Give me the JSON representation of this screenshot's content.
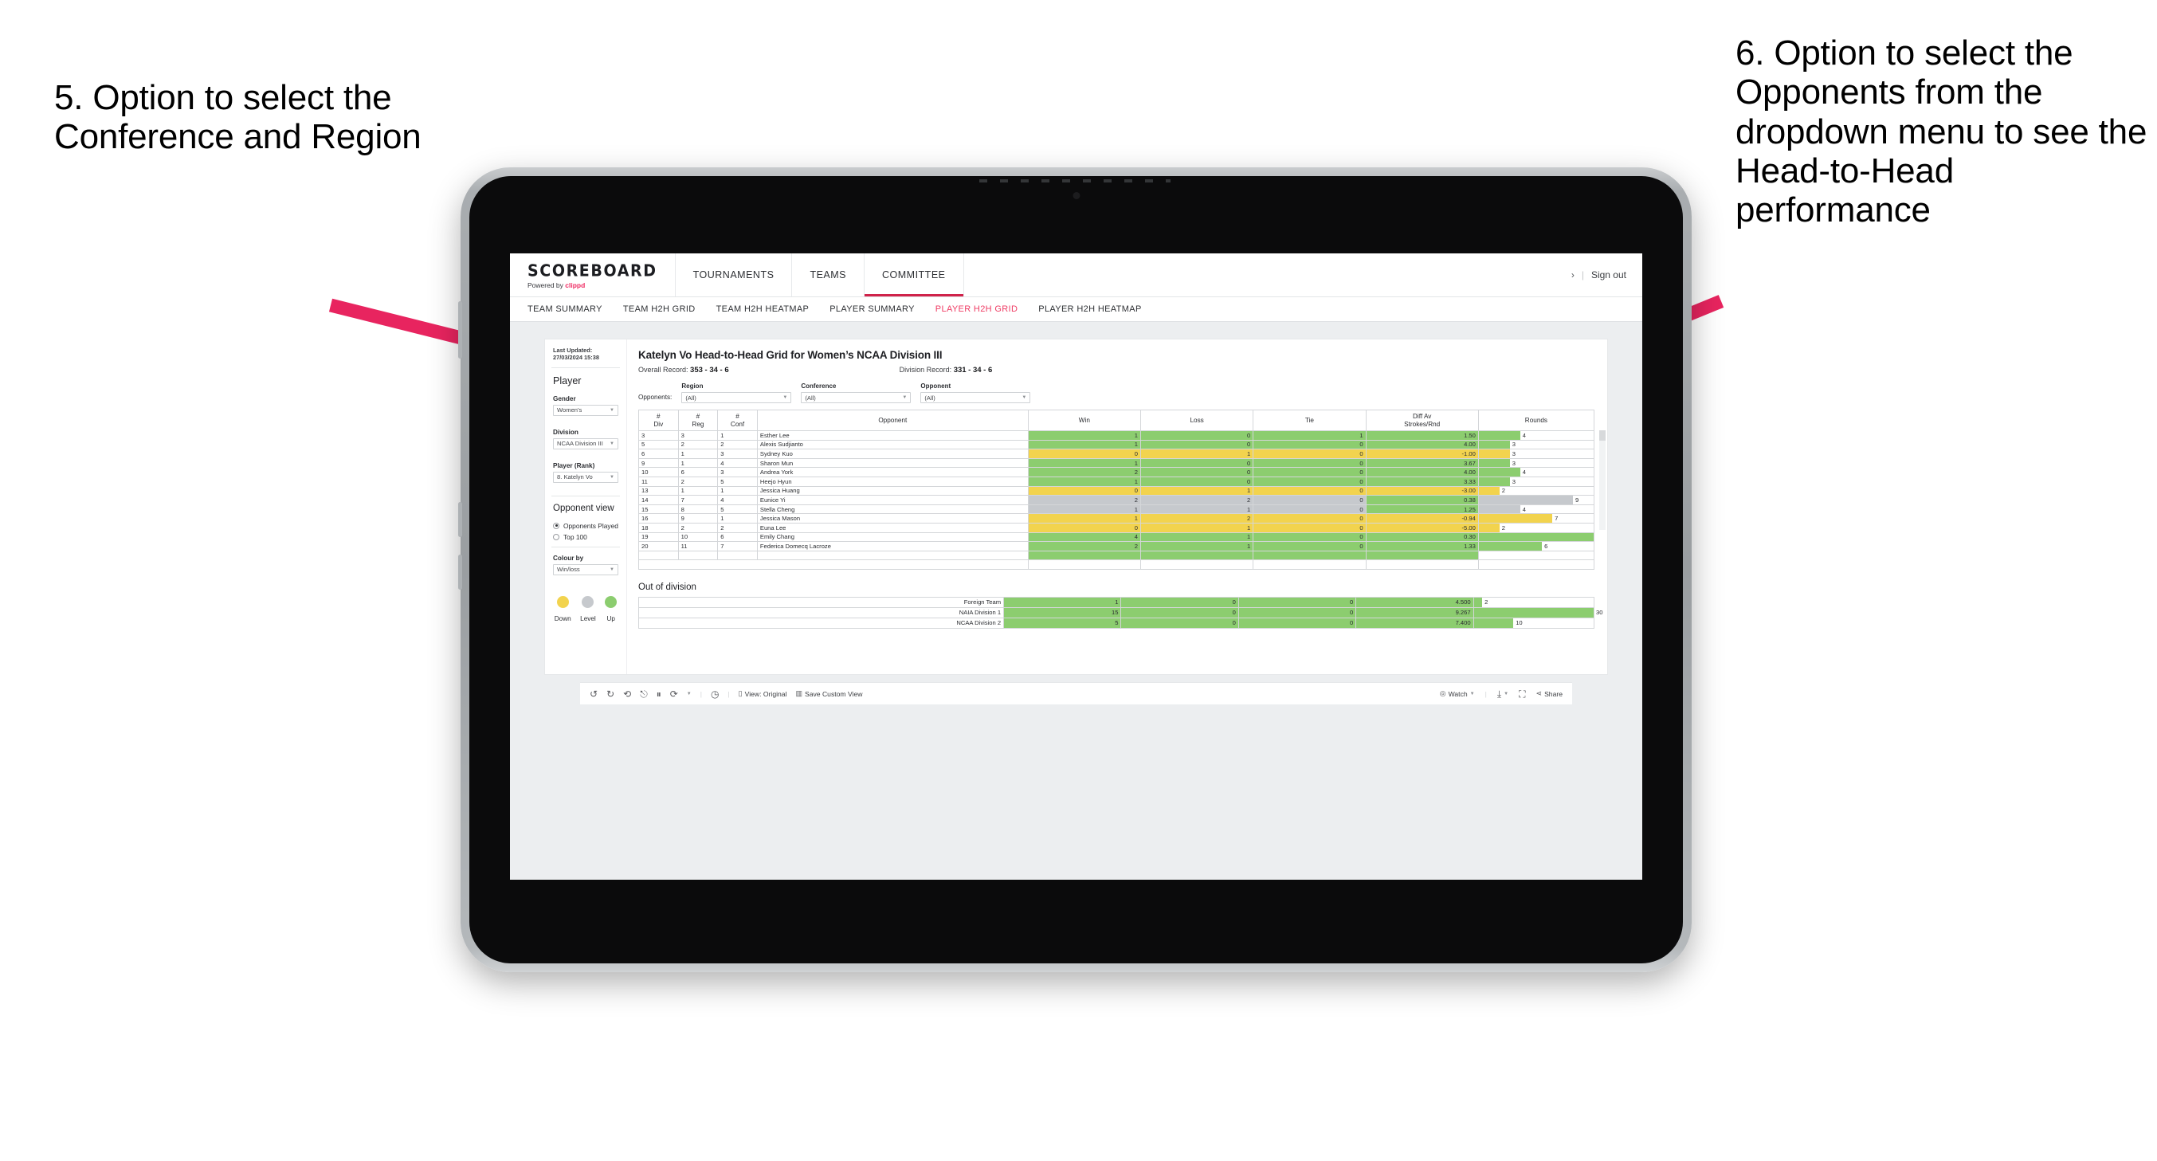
{
  "annotations": {
    "left": "5. Option to select the Conference and Region",
    "right": "6. Option to select the Opponents from the dropdown menu to see the Head-to-Head performance",
    "arrow_color": "#e8245f"
  },
  "app": {
    "brand": {
      "title": "SCOREBOARD",
      "powered_prefix": "Powered by",
      "powered_brand": "clippd"
    },
    "topnav": [
      {
        "label": "TOURNAMENTS",
        "active": false
      },
      {
        "label": "TEAMS",
        "active": false
      },
      {
        "label": "COMMITTEE",
        "active": true
      }
    ],
    "topnav_right": {
      "chevron": "›",
      "separator": "|",
      "sign_out": "Sign out"
    },
    "subnav": [
      {
        "label": "TEAM SUMMARY",
        "active": false
      },
      {
        "label": "TEAM H2H GRID",
        "active": false
      },
      {
        "label": "TEAM H2H HEATMAP",
        "active": false
      },
      {
        "label": "PLAYER SUMMARY",
        "active": false
      },
      {
        "label": "PLAYER H2H GRID",
        "active": true
      },
      {
        "label": "PLAYER H2H HEATMAP",
        "active": false
      }
    ]
  },
  "sidebar": {
    "last_updated": "Last Updated: 27/03/2024 15:38",
    "player_heading": "Player",
    "gender": {
      "label": "Gender",
      "value": "Women's"
    },
    "division": {
      "label": "Division",
      "value": "NCAA Division III"
    },
    "player_rank": {
      "label": "Player (Rank)",
      "value": "8. Katelyn Vo"
    },
    "opponent_view": {
      "heading": "Opponent view",
      "options": [
        {
          "label": "Opponents Played",
          "selected": true
        },
        {
          "label": "Top 100",
          "selected": false
        }
      ]
    },
    "colour_by": {
      "label": "Colour by",
      "value": "Win/loss"
    },
    "legend": [
      {
        "label": "Down",
        "color": "#f2d34e"
      },
      {
        "label": "Level",
        "color": "#c6c9cd"
      },
      {
        "label": "Up",
        "color": "#8ccd6f"
      }
    ]
  },
  "viz": {
    "title": "Katelyn Vo Head-to-Head Grid for Women’s NCAA Division III",
    "overall_record_label": "Overall Record:",
    "overall_record_value": "353 - 34 - 6",
    "division_record_label": "Division Record:",
    "division_record_value": "331 - 34 - 6",
    "filters_lead": "Opponents:",
    "filters": [
      {
        "label": "Region",
        "value": "(All)"
      },
      {
        "label": "Conference",
        "value": "(All)"
      },
      {
        "label": "Opponent",
        "value": "(All)"
      }
    ],
    "out_of_division_title": "Out of division"
  },
  "chart_data": {
    "type": "table",
    "title": "Katelyn Vo Head-to-Head Grid for Women’s NCAA Division III",
    "columns": [
      "# Div",
      "# Reg",
      "# Conf",
      "Opponent",
      "Win",
      "Loss",
      "Tie",
      "Diff Av Strokes/Rnd",
      "Rounds"
    ],
    "column_headers_two_line": [
      {
        "l1": "#",
        "l2": "Div"
      },
      {
        "l1": "#",
        "l2": "Reg"
      },
      {
        "l1": "#",
        "l2": "Conf"
      },
      {
        "l1": "Opponent",
        "l2": ""
      },
      {
        "l1": "Win",
        "l2": ""
      },
      {
        "l1": "Loss",
        "l2": ""
      },
      {
        "l1": "Tie",
        "l2": ""
      },
      {
        "l1": "Diff Av",
        "l2": "Strokes/Rnd"
      },
      {
        "l1": "Rounds",
        "l2": ""
      }
    ],
    "rounds_max": 11,
    "rows": [
      {
        "div": "3",
        "reg": "3",
        "conf": "1",
        "opponent": "Esther Lee",
        "win": "1",
        "loss": "0",
        "tie": "1",
        "diff": "1.50",
        "rounds": "4",
        "color": "#8ccd6f"
      },
      {
        "div": "5",
        "reg": "2",
        "conf": "2",
        "opponent": "Alexis Sudjianto",
        "win": "1",
        "loss": "0",
        "tie": "0",
        "diff": "4.00",
        "rounds": "3",
        "color": "#8ccd6f"
      },
      {
        "div": "6",
        "reg": "1",
        "conf": "3",
        "opponent": "Sydney Kuo",
        "win": "0",
        "loss": "1",
        "tie": "0",
        "diff": "-1.00",
        "rounds": "3",
        "color": "#f2d34e"
      },
      {
        "div": "9",
        "reg": "1",
        "conf": "4",
        "opponent": "Sharon Mun",
        "win": "1",
        "loss": "0",
        "tie": "0",
        "diff": "3.67",
        "rounds": "3",
        "color": "#8ccd6f"
      },
      {
        "div": "10",
        "reg": "6",
        "conf": "3",
        "opponent": "Andrea York",
        "win": "2",
        "loss": "0",
        "tie": "0",
        "diff": "4.00",
        "rounds": "4",
        "color": "#8ccd6f"
      },
      {
        "div": "11",
        "reg": "2",
        "conf": "5",
        "opponent": "Heejo Hyun",
        "win": "1",
        "loss": "0",
        "tie": "0",
        "diff": "3.33",
        "rounds": "3",
        "color": "#8ccd6f"
      },
      {
        "div": "13",
        "reg": "1",
        "conf": "1",
        "opponent": "Jessica Huang",
        "win": "0",
        "loss": "1",
        "tie": "0",
        "diff": "-3.00",
        "rounds": "2",
        "color": "#f2d34e"
      },
      {
        "div": "14",
        "reg": "7",
        "conf": "4",
        "opponent": "Eunice Yi",
        "win": "2",
        "loss": "2",
        "tie": "0",
        "diff": "0.38",
        "rounds": "9",
        "color": "#c6c9cd",
        "diff_color": "#8ccd6f"
      },
      {
        "div": "15",
        "reg": "8",
        "conf": "5",
        "opponent": "Stella Cheng",
        "win": "1",
        "loss": "1",
        "tie": "0",
        "diff": "1.25",
        "rounds": "4",
        "color": "#c6c9cd",
        "diff_color": "#8ccd6f"
      },
      {
        "div": "16",
        "reg": "9",
        "conf": "1",
        "opponent": "Jessica Mason",
        "win": "1",
        "loss": "2",
        "tie": "0",
        "diff": "-0.94",
        "rounds": "7",
        "color": "#f2d34e"
      },
      {
        "div": "18",
        "reg": "2",
        "conf": "2",
        "opponent": "Euna Lee",
        "win": "0",
        "loss": "1",
        "tie": "0",
        "diff": "-5.00",
        "rounds": "2",
        "color": "#f2d34e"
      },
      {
        "div": "19",
        "reg": "10",
        "conf": "6",
        "opponent": "Emily Chang",
        "win": "4",
        "loss": "1",
        "tie": "0",
        "diff": "0.30",
        "rounds": "11",
        "color": "#8ccd6f"
      },
      {
        "div": "20",
        "reg": "11",
        "conf": "7",
        "opponent": "Federica Domecq Lacroze",
        "win": "2",
        "loss": "1",
        "tie": "0",
        "diff": "1.33",
        "rounds": "6",
        "color": "#8ccd6f"
      }
    ],
    "out_of_division": [
      {
        "label": "Foreign Team",
        "win": "1",
        "loss": "0",
        "tie": "0",
        "diff": "4.500",
        "rounds": "2",
        "color": "#8ccd6f"
      },
      {
        "label": "NAIA Division 1",
        "win": "15",
        "loss": "0",
        "tie": "0",
        "diff": "9.267",
        "rounds": "30",
        "color": "#8ccd6f"
      },
      {
        "label": "NCAA Division 2",
        "win": "5",
        "loss": "0",
        "tie": "0",
        "diff": "7.400",
        "rounds": "10",
        "color": "#8ccd6f"
      }
    ],
    "out_of_division_rounds_max": 30
  },
  "toolbar": {
    "icons": [
      "undo-icon",
      "redo-icon",
      "revert-icon",
      "refresh-icon",
      "pause-icon",
      "reset-icon"
    ],
    "view_label": "View: Original",
    "save_custom_view": "Save Custom View",
    "watch": "Watch",
    "share": "Share"
  }
}
